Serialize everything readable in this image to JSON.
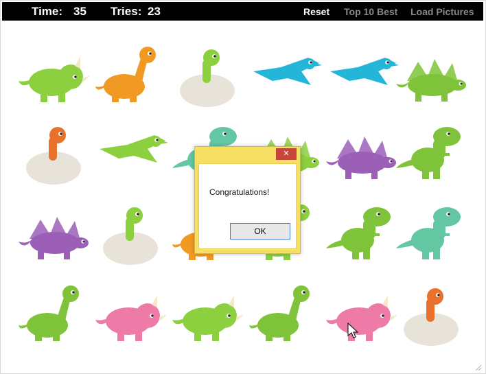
{
  "topbar": {
    "time_label": "Time:",
    "time_value": "35",
    "tries_label": "Tries:",
    "tries_value": "23",
    "menu": [
      "Reset",
      "Top 10 Best",
      "Load Pictures"
    ]
  },
  "dialog": {
    "close_symbol": "✕",
    "message": "Congratulations!",
    "ok_label": "OK"
  },
  "cards": [
    {
      "kind": "triceratops",
      "color": "#8ccf3f"
    },
    {
      "kind": "longneck",
      "color": "#f09a24"
    },
    {
      "kind": "egg",
      "color": "#8ccf3f"
    },
    {
      "kind": "pterodactyl",
      "color": "#23b6d8"
    },
    {
      "kind": "pterodactyl",
      "color": "#23b6d8"
    },
    {
      "kind": "stegosaurus",
      "color": "#7ec33a"
    },
    {
      "kind": "egg",
      "color": "#e8712c"
    },
    {
      "kind": "pterodactyl",
      "color": "#8ccf3f"
    },
    {
      "kind": "trex",
      "color": "#64c7a4"
    },
    {
      "kind": "stegosaurus",
      "color": "#8ccf3f"
    },
    {
      "kind": "stegosaurus",
      "color": "#9b5fb8"
    },
    {
      "kind": "trex",
      "color": "#7ec33a"
    },
    {
      "kind": "stegosaurus",
      "color": "#9b5fb8"
    },
    {
      "kind": "egg",
      "color": "#8ccf3f"
    },
    {
      "kind": "longneck",
      "color": "#f09a24"
    },
    {
      "kind": "longneck",
      "color": "#8ccf3f"
    },
    {
      "kind": "trex",
      "color": "#7ec33a"
    },
    {
      "kind": "trex",
      "color": "#64c7a4"
    },
    {
      "kind": "longneck",
      "color": "#7ec33a"
    },
    {
      "kind": "triceratops",
      "color": "#ee7aa8"
    },
    {
      "kind": "triceratops",
      "color": "#8ccf3f"
    },
    {
      "kind": "longneck",
      "color": "#7ec33a"
    },
    {
      "kind": "triceratops",
      "color": "#ee7aa8"
    },
    {
      "kind": "egg",
      "color": "#e8712c"
    }
  ]
}
